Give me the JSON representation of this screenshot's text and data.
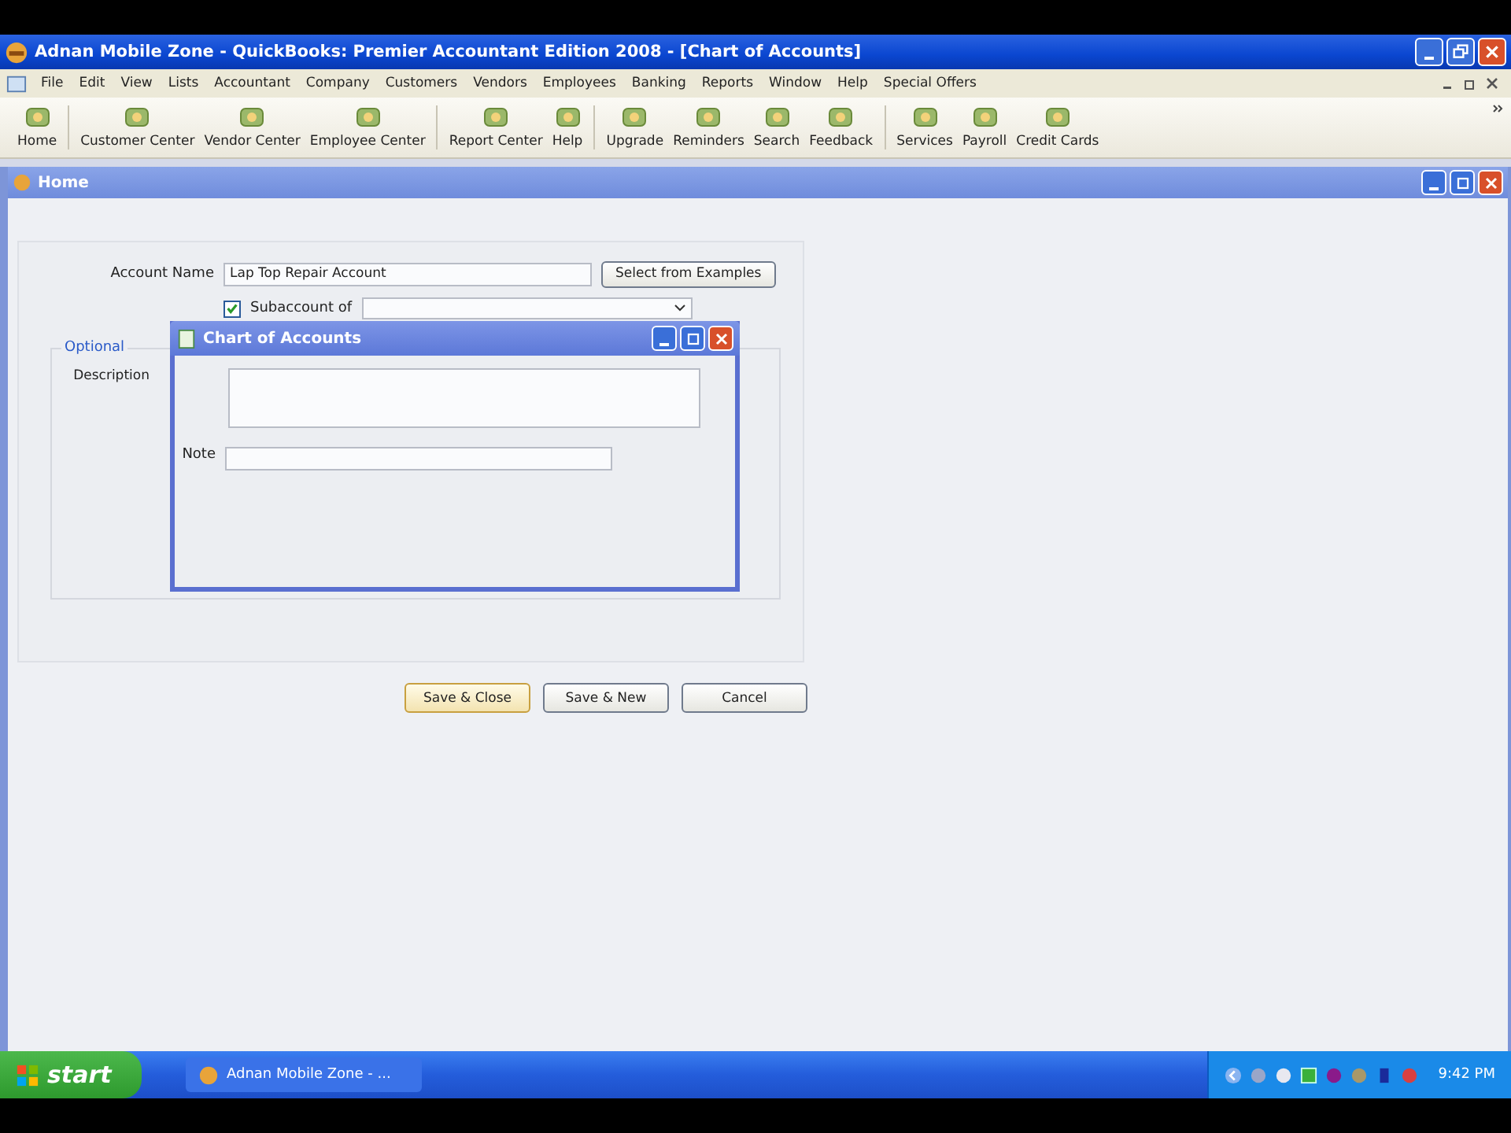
{
  "window": {
    "title": "Adnan Mobile Zone  - QuickBooks: Premier Accountant Edition 2008 - [Chart of Accounts]"
  },
  "menu": [
    "File",
    "Edit",
    "View",
    "Lists",
    "Accountant",
    "Company",
    "Customers",
    "Vendors",
    "Employees",
    "Banking",
    "Reports",
    "Window",
    "Help",
    "Special Offers"
  ],
  "toolbar": [
    {
      "items": [
        "Home"
      ]
    },
    {
      "items": [
        "Customer Center",
        "Vendor Center",
        "Employee Center"
      ]
    },
    {
      "items": [
        "Report Center",
        "Help"
      ]
    },
    {
      "items": [
        "Upgrade",
        "Reminders",
        "Search",
        "Feedback"
      ]
    },
    {
      "items": [
        "Services",
        "Payroll",
        "Credit Cards"
      ]
    }
  ],
  "home_window": {
    "title": "Home"
  },
  "form": {
    "account_name": {
      "label": "Account Name",
      "value": "Lap Top Repair Account"
    },
    "examples_button": "Select from Examples",
    "subaccount": {
      "label": "Subaccount of",
      "checked": true
    },
    "optional": {
      "legend": "Optional",
      "description_label": "Description",
      "note_label": "Note"
    },
    "buttons": [
      {
        "label": "Save & Close",
        "focused": true
      },
      {
        "label": "Save & New",
        "focused": false
      },
      {
        "label": "Cancel",
        "focused": false
      }
    ]
  },
  "dialog": {
    "title": "Chart of Accounts"
  },
  "taskbar": {
    "start": "start",
    "tasks": [
      "Adnan Mobile Zone - ..."
    ],
    "clock": "9:42 PM"
  }
}
